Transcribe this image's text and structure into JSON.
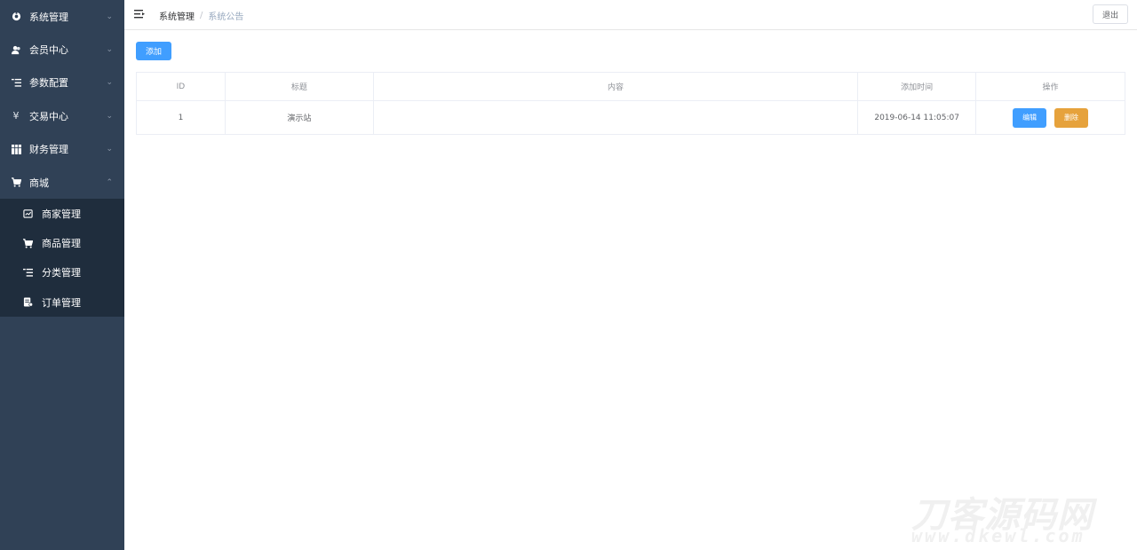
{
  "sidebar": {
    "items": [
      {
        "label": "系统管理",
        "icon": "gear-icon"
      },
      {
        "label": "会员中心",
        "icon": "users-icon"
      },
      {
        "label": "参数配置",
        "icon": "list-icon"
      },
      {
        "label": "交易中心",
        "icon": "yen-icon"
      },
      {
        "label": "财务管理",
        "icon": "grid-icon"
      },
      {
        "label": "商城",
        "icon": "cart-icon"
      }
    ],
    "subitems": [
      {
        "label": "商家管理",
        "icon": "shop-icon"
      },
      {
        "label": "商品管理",
        "icon": "cart-icon"
      },
      {
        "label": "分类管理",
        "icon": "list-icon"
      },
      {
        "label": "订单管理",
        "icon": "order-icon"
      }
    ]
  },
  "header": {
    "breadcrumb": [
      "系统管理",
      "系统公告"
    ],
    "separator": "/",
    "logout_label": "退出"
  },
  "main": {
    "add_label": "添加",
    "table": {
      "headers": [
        "ID",
        "标题",
        "内容",
        "添加时间",
        "操作"
      ],
      "rows": [
        {
          "id": "1",
          "title": "演示站",
          "content": "",
          "time": "2019-06-14 11:05:07",
          "edit_label": "编辑",
          "delete_label": "删除"
        }
      ]
    }
  },
  "watermark": {
    "line1": "刀客源码网",
    "line2": "www.dkewl.com"
  },
  "colors": {
    "sidebar_bg": "#304156",
    "submenu_bg": "#1f2d3d",
    "primary": "#409eff",
    "warning": "#e6a23c"
  }
}
